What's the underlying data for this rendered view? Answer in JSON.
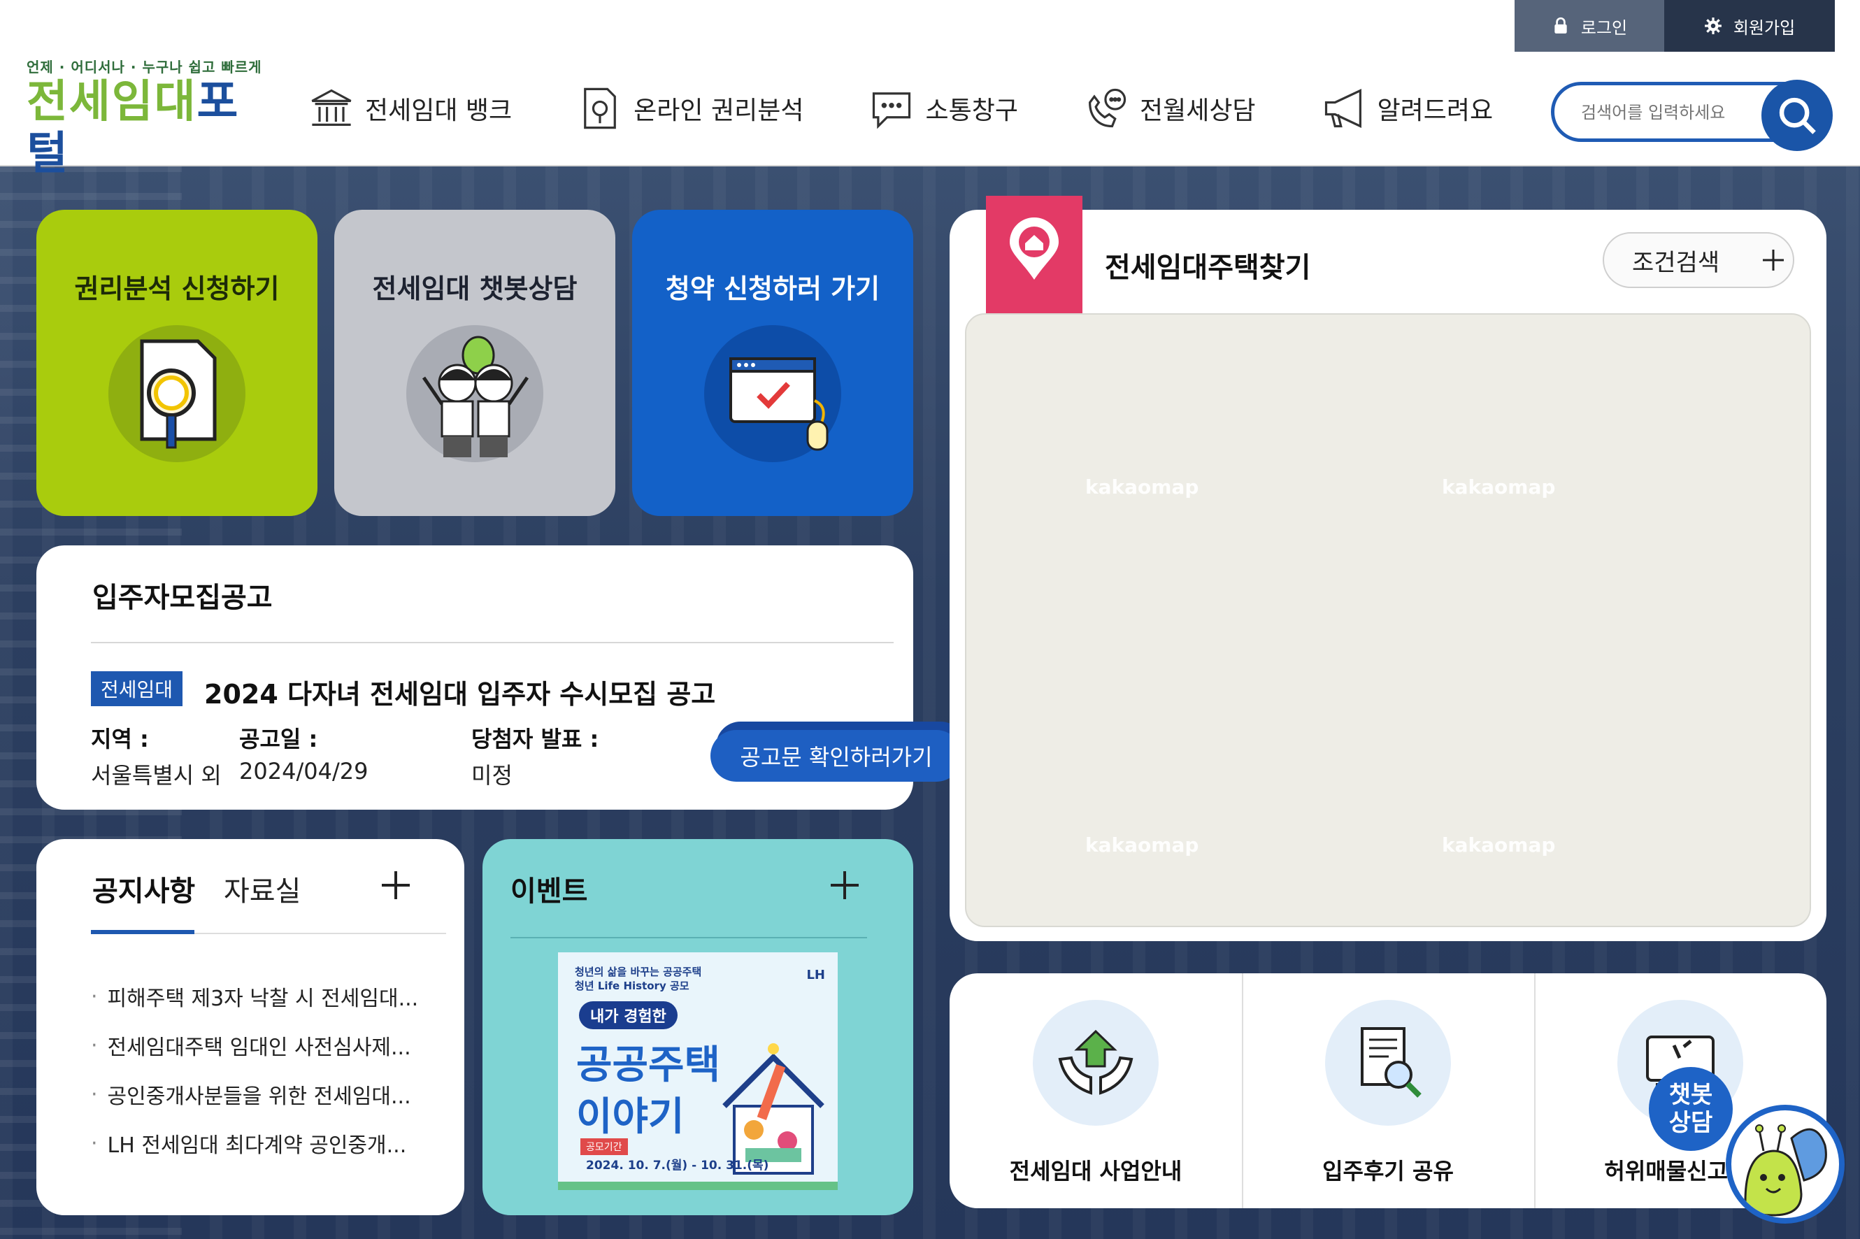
{
  "header": {
    "logo_tagline": "언제 · 어디서나 · 누구나 쉽고 빠르게",
    "logo_title_a": "전세임대",
    "logo_title_b": "포털",
    "login_label": "로그인",
    "join_label": "회원가입",
    "nav": [
      {
        "label": "전세임대 뱅크",
        "icon": "bank-icon"
      },
      {
        "label": "온라인 권리분석",
        "icon": "document-search-icon"
      },
      {
        "label": "소통창구",
        "icon": "chat-bubble-icon"
      },
      {
        "label": "전월세상담",
        "icon": "phone-chat-icon"
      },
      {
        "label": "알려드려요",
        "icon": "megaphone-icon"
      }
    ],
    "search_placeholder": "검색어를 입력하세요"
  },
  "quick": [
    {
      "label": "권리분석 신청하기",
      "icon": "magnifier-document-icon"
    },
    {
      "label": "전세임대 챗봇상담",
      "icon": "people-cheer-icon"
    },
    {
      "label": "청약 신청하러 가기",
      "icon": "browser-check-icon"
    }
  ],
  "recruit": {
    "title": "입주자모집공고",
    "badge": "전세임대",
    "headline": "2024 다자녀 전세임대 입주자 수시모집 공고",
    "region_label": "지역 :",
    "region_value": "서울특별시 외",
    "date_label": "공고일 :",
    "date_value": "2024/04/29",
    "winner_label": "당첨자 발표 :",
    "winner_value": "미정",
    "button": "공고문 확인하러가기"
  },
  "notice": {
    "tab_active": "공지사항",
    "tab_other": "자료실",
    "items": [
      "피해주택 제3자 낙찰 시 전세임대...",
      "전세임대주택 임대인 사전심사제...",
      "공인중개사분들을 위한 전세임대...",
      "LH 전세임대 최다계약 공인중개..."
    ]
  },
  "event": {
    "title": "이벤트",
    "poster_small_1": "청년의 삶을 바꾸는 공공주택",
    "poster_small_2": "청년 Life History 공모",
    "poster_lh": "LH",
    "poster_pill": "내가 경험한",
    "poster_big_1": "공공주택",
    "poster_big_2": "이야기",
    "poster_period_tag": "공모기간",
    "poster_period": "2024. 10. 7.(월) - 10. 31.(목)"
  },
  "map": {
    "title": "전세임대주택찾기",
    "condition_button": "조건검색",
    "watermark": "kakaomap"
  },
  "services": [
    {
      "label": "전세임대 사업안내",
      "icon": "hands-house-icon"
    },
    {
      "label": "입주후기 공유",
      "icon": "review-document-icon"
    },
    {
      "label": "허위매물신고 및",
      "icon": "report-monitor-icon"
    }
  ],
  "chatbot": {
    "line1": "챗봇",
    "line2": "상담"
  },
  "colors": {
    "brand_blue": "#1e58b0",
    "lime": "#a9cc0d",
    "gray_card": "#c4c6cc",
    "blue_card": "#1361c8",
    "event_teal": "#7fd4d4",
    "pin_pink": "#e33a66"
  }
}
